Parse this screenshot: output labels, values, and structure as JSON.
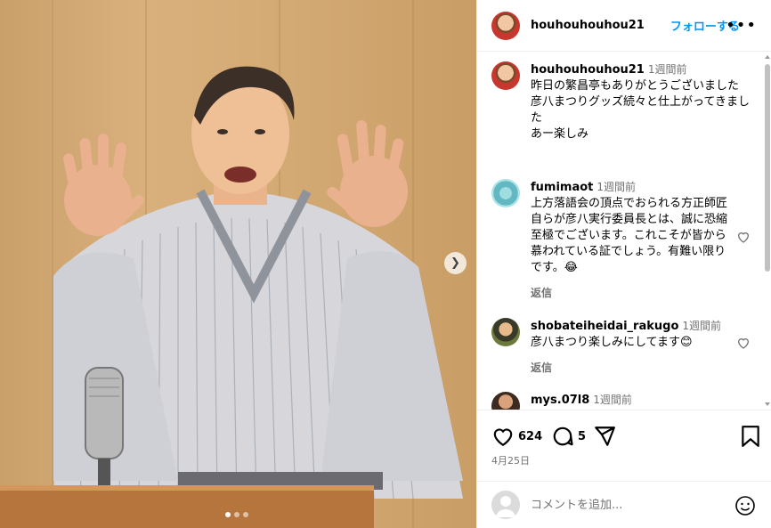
{
  "post": {
    "username": "houhouhouhou21",
    "follow_label": "フォローする",
    "more_label": "•••",
    "caption": {
      "username": "houhouhouhou21",
      "time": "1週間前",
      "text": "昨日の繁昌亭もありがとうございました\n彦八まつりグッズ続々と仕上がってきました\nあー楽しみ"
    },
    "comments": [
      {
        "username": "fumimaot",
        "time": "1週間前",
        "text": "上方落語会の頂点でおられる方正師匠自らが彦八実行委員長とは、誠に恐縮至極でございます。これこそが皆から慕われている証でしょう。有難い限りです。😂",
        "reply_label": "返信"
      },
      {
        "username": "shobateiheidai_rakugo",
        "time": "1週間前",
        "text": "彦八まつり楽しみにしてます😊",
        "reply_label": "返信"
      },
      {
        "username": "mys.07l8",
        "time": "1週間前",
        "text": ""
      }
    ],
    "likes": "624",
    "comment_count": "5",
    "date": "4月25日",
    "add_comment_placeholder": "コメントを追加...",
    "carousel": {
      "total": 3,
      "active": 1
    }
  },
  "colors": {
    "accent": "#0095f6",
    "muted": "#737373",
    "divider": "#efefef"
  },
  "icons": [
    "chevron-right-icon",
    "more-icon",
    "heart-icon",
    "comment-icon",
    "share-icon",
    "bookmark-icon",
    "emoji-icon",
    "user-icon"
  ]
}
